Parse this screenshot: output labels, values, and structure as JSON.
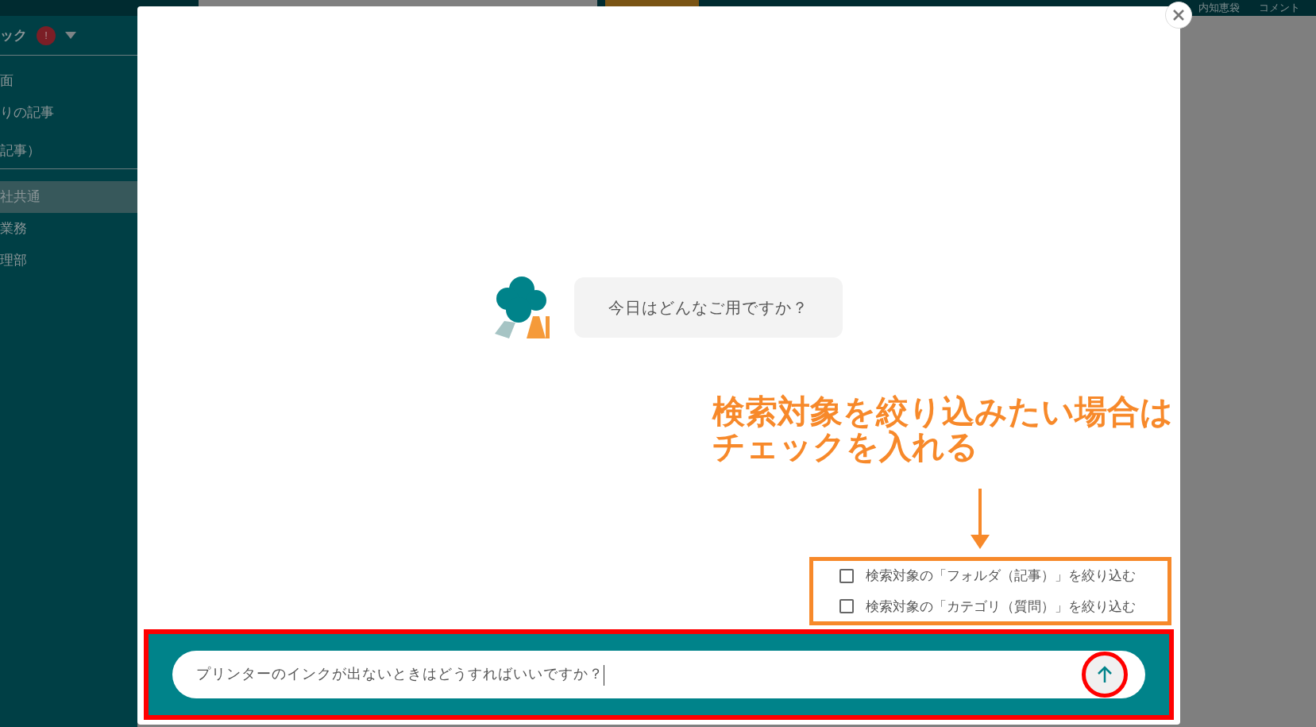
{
  "top_nav": {
    "items": [
      "内知恵袋",
      "コメント"
    ]
  },
  "sidebar": {
    "header": {
      "label": "ック",
      "badge": "!"
    },
    "items": [
      {
        "label": "面",
        "selected": false
      },
      {
        "label": "りの記事",
        "selected": false
      },
      {
        "label": "記事）",
        "selected": false
      },
      {
        "label": "社共通",
        "selected": true
      },
      {
        "label": "業務",
        "selected": false
      },
      {
        "label": "理部",
        "selected": false
      }
    ]
  },
  "modal": {
    "message": "今日はどんなご用ですか？",
    "annotation": [
      "検索対象を絞り込みたい場合は",
      "チェックを入れる"
    ],
    "filters": [
      {
        "label": "検索対象の「フォルダ（記事）」を絞り込む",
        "checked": false
      },
      {
        "label": "検索対象の「カテゴリ（質問）」を絞り込む",
        "checked": false
      }
    ],
    "input": {
      "value": "プリンターのインクが出ないときはどうすればいいですか？"
    }
  }
}
